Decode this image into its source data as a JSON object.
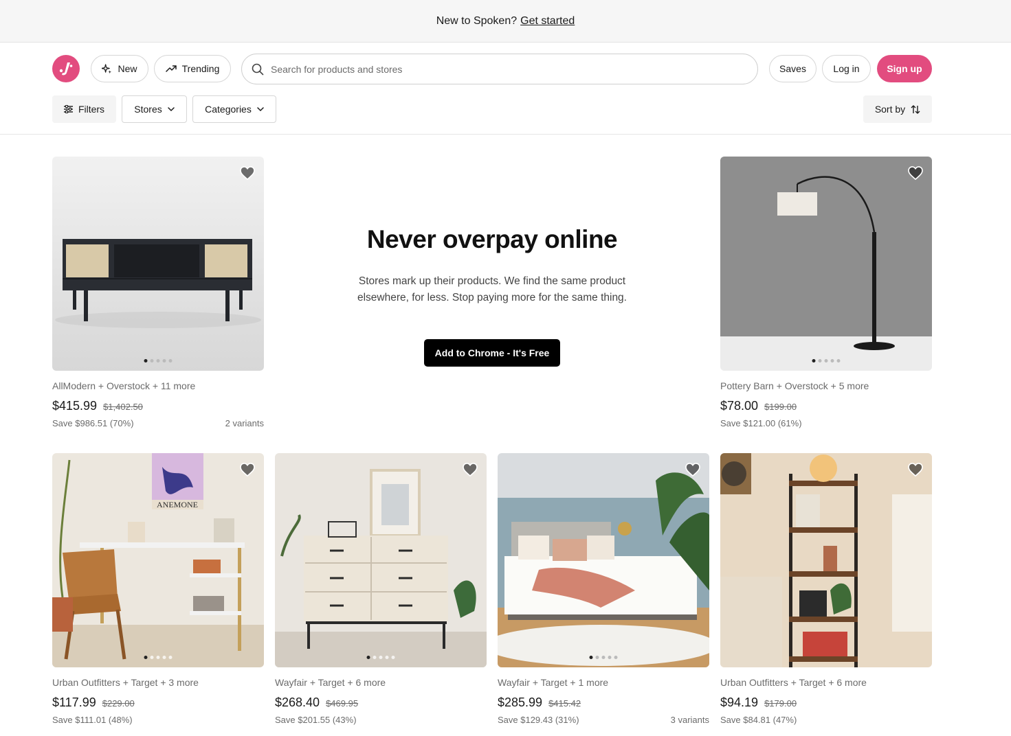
{
  "banner": {
    "text": "New to Spoken?",
    "link": "Get started"
  },
  "header": {
    "new_label": "New",
    "trending_label": "Trending",
    "search_placeholder": "Search for products and stores",
    "saves_label": "Saves",
    "login_label": "Log in",
    "signup_label": "Sign up"
  },
  "filters": {
    "filters_label": "Filters",
    "stores_label": "Stores",
    "categories_label": "Categories",
    "sort_label": "Sort by"
  },
  "promo": {
    "title": "Never overpay online",
    "body": "Stores mark up their products. We find the same product elsewhere, for less. Stop paying more for the same thing.",
    "cta": "Add to Chrome - It's Free"
  },
  "products": [
    {
      "stores": "AllModern + Overstock + 11 more",
      "price": "$415.99",
      "original": "$1,402.50",
      "save": "Save $986.51 (70%)",
      "variants": "2 variants",
      "image": "black-rattan-media-console",
      "image_count": 5,
      "active": 0
    },
    {
      "stores": "Pottery Barn + Overstock + 5 more",
      "price": "$78.00",
      "original": "$199.00",
      "save": "Save $121.00 (61%)",
      "variants": "",
      "image": "black-arc-floor-lamp",
      "image_count": 5,
      "active": 0
    },
    {
      "stores": "Urban Outfitters + Target + 3 more",
      "price": "$117.99",
      "original": "$229.00",
      "save": "Save $111.01 (48%)",
      "variants": "",
      "image": "gold-white-desk-with-chair",
      "image_count": 5,
      "active": 0
    },
    {
      "stores": "Wayfair + Target + 6 more",
      "price": "$268.40",
      "original": "$469.95",
      "save": "Save $201.55 (43%)",
      "variants": "",
      "image": "cream-six-drawer-dresser",
      "image_count": 5,
      "active": 0
    },
    {
      "stores": "Wayfair + Target + 1 more",
      "price": "$285.99",
      "original": "$415.42",
      "save": "Save $129.43 (31%)",
      "variants": "3 variants",
      "image": "upholstered-bed-white-bedding",
      "image_count": 5,
      "active": 0
    },
    {
      "stores": "Urban Outfitters + Target + 6 more",
      "price": "$94.19",
      "original": "$179.00",
      "save": "Save $84.81 (47%)",
      "variants": "",
      "image": "wood-metal-bookshelf",
      "image_count": 5,
      "active": 0
    }
  ],
  "colors": {
    "brand": "#e24c7f",
    "cta": "#000000"
  }
}
